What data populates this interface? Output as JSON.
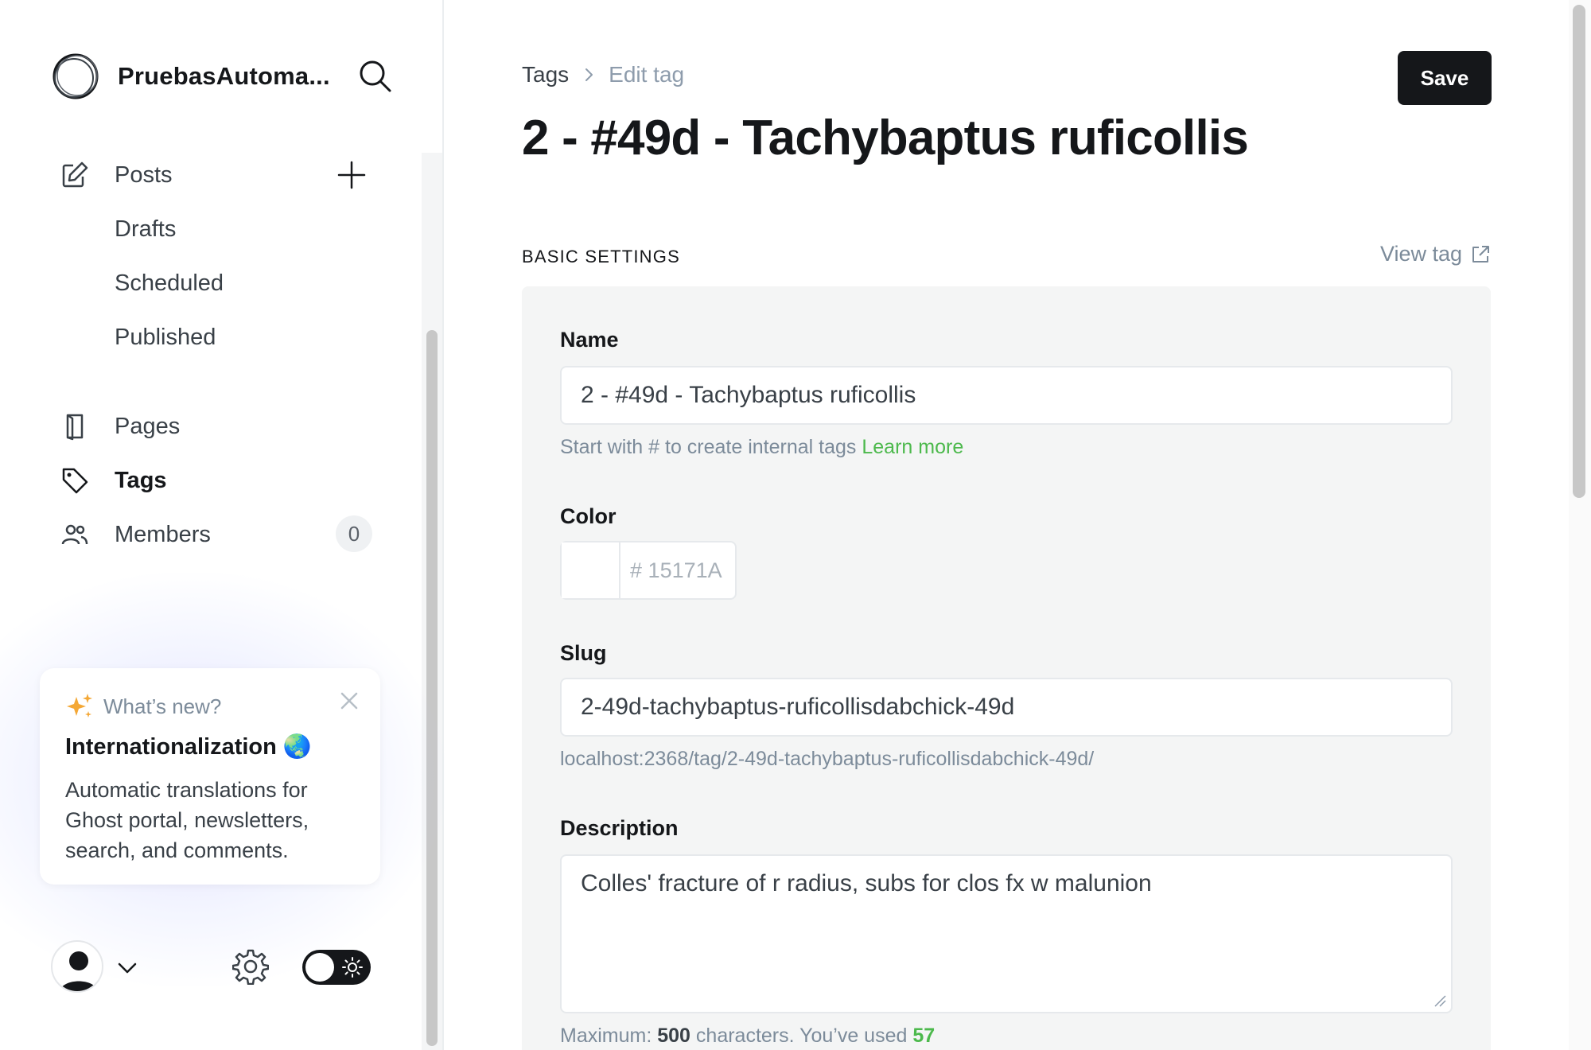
{
  "sidebar": {
    "site_name": "PruebasAutoma...",
    "nav": {
      "posts": "Posts",
      "drafts": "Drafts",
      "scheduled": "Scheduled",
      "published": "Published",
      "pages": "Pages",
      "tags": "Tags",
      "members": "Members",
      "members_count": "0"
    },
    "whats_new": {
      "header": "What’s new?",
      "title": "Internationalization 🌏",
      "body": "Automatic translations for Ghost portal, newsletters, search, and comments."
    },
    "icons": [
      "ghost-logo-icon",
      "search-icon",
      "pencil-square-icon",
      "plus-icon",
      "pages-icon",
      "tag-icon",
      "members-icon",
      "sparkle-icon",
      "close-icon",
      "user-avatar-icon",
      "chevron-down-icon",
      "gear-icon",
      "sun-icon"
    ]
  },
  "header": {
    "breadcrumb_root": "Tags",
    "breadcrumb_current": "Edit tag",
    "title": "2 - #49d - Tachybaptus ruficollis",
    "save_label": "Save"
  },
  "basic_settings": {
    "section_title": "BASIC SETTINGS",
    "view_tag": "View tag",
    "name_label": "Name",
    "name_value": "2 - #49d - Tachybaptus ruficollis",
    "name_hint": "Start with # to create internal tags",
    "name_hint_link": "Learn more",
    "color_label": "Color",
    "color_hash": "#",
    "color_placeholder": "15171A",
    "slug_label": "Slug",
    "slug_value": "2-49d-tachybaptus-ruficollisdabchick-49d",
    "slug_url": "localhost:2368/tag/2-49d-tachybaptus-ruficollisdabchick-49d/",
    "description_label": "Description",
    "description_value": "Colles' fracture of r radius, subs for clos fx w malunion",
    "desc_hint_prefix": "Maximum:",
    "desc_hint_max": "500",
    "desc_hint_mid": "characters. You’ve used",
    "desc_hint_used": "57"
  },
  "colors": {
    "primary": "#15171a",
    "accent_green": "#4cb94c",
    "muted": "#7c8b9a",
    "panel_bg": "#f4f5f5"
  }
}
